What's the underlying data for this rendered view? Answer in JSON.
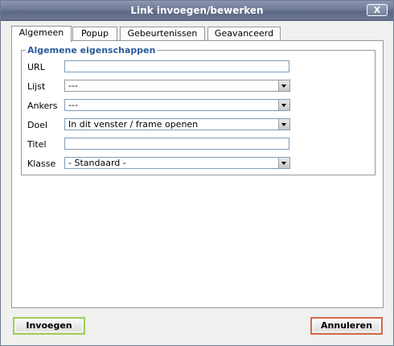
{
  "window": {
    "title": "Link invoegen/bewerken",
    "close_label": "X"
  },
  "tabs": [
    {
      "label": "Algemeen",
      "active": true
    },
    {
      "label": "Popup",
      "active": false
    },
    {
      "label": "Gebeurtenissen",
      "active": false
    },
    {
      "label": "Geavanceerd",
      "active": false
    }
  ],
  "section": {
    "legend": "Algemene eigenschappen",
    "fields": {
      "url": {
        "label": "URL",
        "value": ""
      },
      "lijst": {
        "label": "Lijst",
        "value": "---"
      },
      "ankers": {
        "label": "Ankers",
        "value": "---"
      },
      "doel": {
        "label": "Doel",
        "value": "In dit venster / frame openen"
      },
      "titel": {
        "label": "Titel",
        "value": ""
      },
      "klasse": {
        "label": "Klasse",
        "value": "- Standaard -"
      }
    }
  },
  "buttons": {
    "insert": "Invoegen",
    "cancel": "Annuleren"
  },
  "colors": {
    "titlebar": "#6f7a96",
    "legend": "#2b5b9a",
    "insert_border": "#9fcf5a",
    "cancel_border": "#d26b4c"
  }
}
